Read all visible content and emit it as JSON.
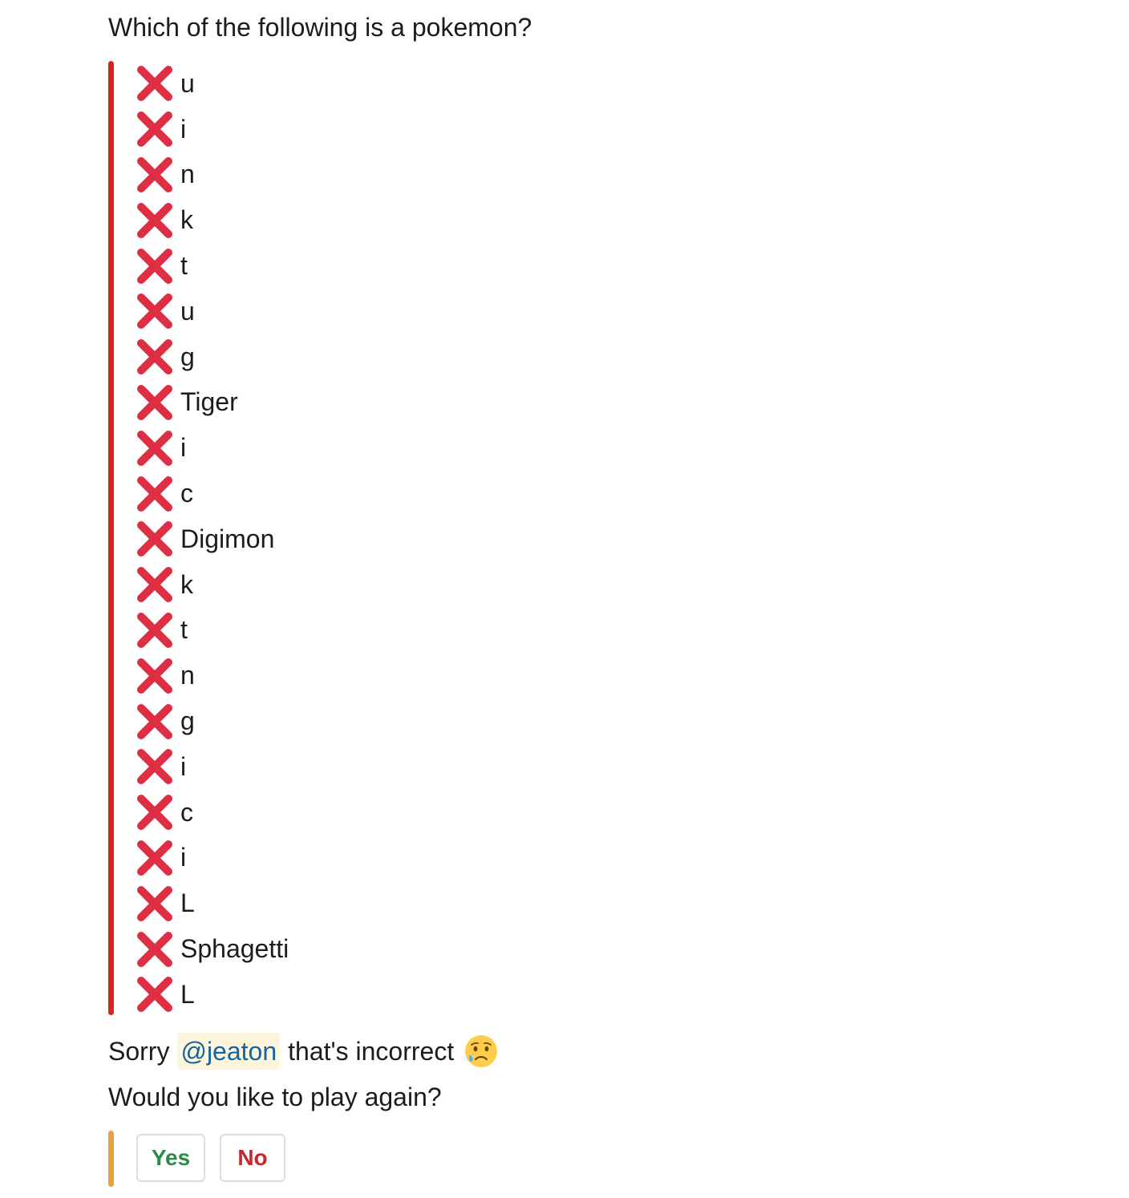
{
  "question": "Which of the following is a pokemon?",
  "options": [
    "u",
    "i",
    "n",
    "k",
    "t",
    "u",
    "g",
    "Tiger",
    "i",
    "c",
    "Digimon",
    "k",
    "t",
    "n",
    "g",
    "i",
    "c",
    "i",
    "L",
    "Sphagetti",
    "L"
  ],
  "option_icon": "cross-mark-icon",
  "result": {
    "prefix": "Sorry",
    "mention": "@jeaton",
    "suffix": "that's incorrect",
    "emoji": "sad-but-relieved-face-icon"
  },
  "prompt": "Would you like to play again?",
  "buttons": {
    "yes_label": "Yes",
    "no_label": "No"
  },
  "colors": {
    "wrong_accent": "#d7261e",
    "cross_mark": "#dd2e44",
    "action_accent": "#e8a33d",
    "yes_text": "#2a8a4a",
    "no_text": "#c62828",
    "mention_text": "#1264a3",
    "mention_bg": "#fdf5dc"
  }
}
